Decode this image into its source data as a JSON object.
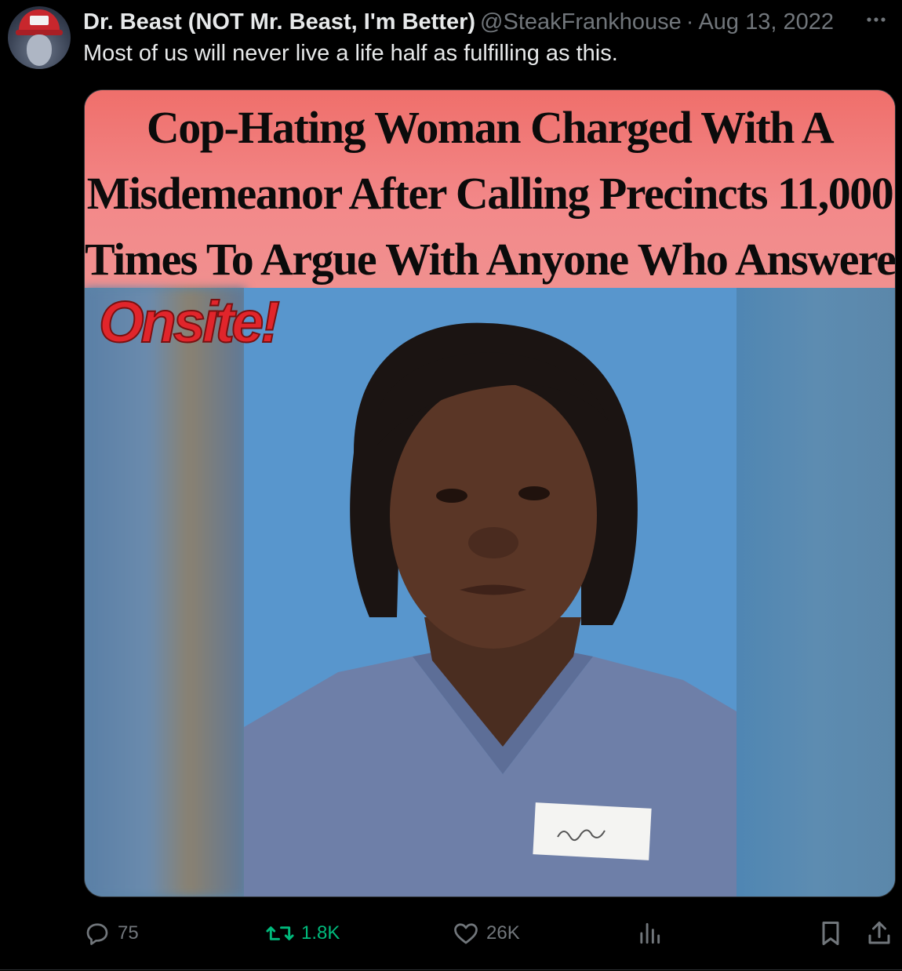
{
  "author": {
    "display_name": "Dr. Beast (NOT Mr. Beast, I'm Better)",
    "handle": "@SteakFrankhouse",
    "separator": "·",
    "date": "Aug 13, 2022"
  },
  "tweet": {
    "text": "Most of us will never live a life half as fulfilling as this."
  },
  "media": {
    "headline_lines": [
      "Cop-Hating Woman Charged With A",
      "Misdemeanor After Calling Precincts 11,000",
      "Times To Argue With Anyone Who Answered"
    ],
    "logo_text": "Onsite!",
    "band_color": "#f07b78",
    "background_color": "#5795cc"
  },
  "actions": {
    "reply_count": "75",
    "retweet_count": "1.8K",
    "like_count": "26K"
  },
  "colors": {
    "muted": "#71767b",
    "text": "#e7e9ea",
    "retweet_green": "#00ba7c",
    "background": "#000000"
  },
  "icons": {
    "more": "more-horizontal-icon",
    "reply": "reply-icon",
    "retweet": "retweet-icon",
    "like": "heart-icon",
    "views": "analytics-icon",
    "bookmark": "bookmark-icon",
    "share": "share-icon"
  }
}
